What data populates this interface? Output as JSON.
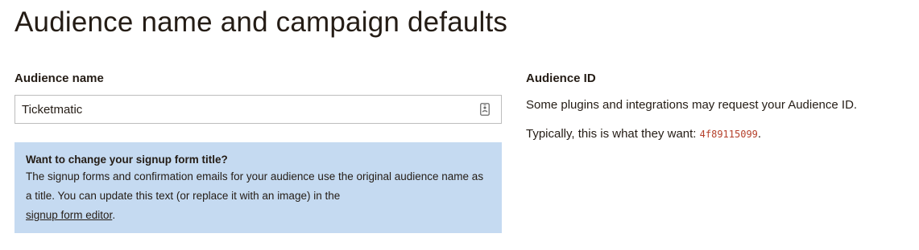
{
  "page": {
    "title": "Audience name and campaign defaults"
  },
  "audience_name": {
    "label": "Audience name",
    "value": "Ticketmatic",
    "icon": "contact-card-icon"
  },
  "info_box": {
    "title": "Want to change your signup form title?",
    "body": "The signup forms and confirmation emails for your audience use the original audience name as a title. You can update this text (or replace it with an image) in the",
    "link_text": "signup form editor",
    "trailing": "."
  },
  "audience_id": {
    "label": "Audience ID",
    "description": "Some plugins and integrations may request your Audience ID.",
    "typically_prefix": "Typically, this is what they want: ",
    "id_value": "4f89115099",
    "typically_suffix": "."
  }
}
